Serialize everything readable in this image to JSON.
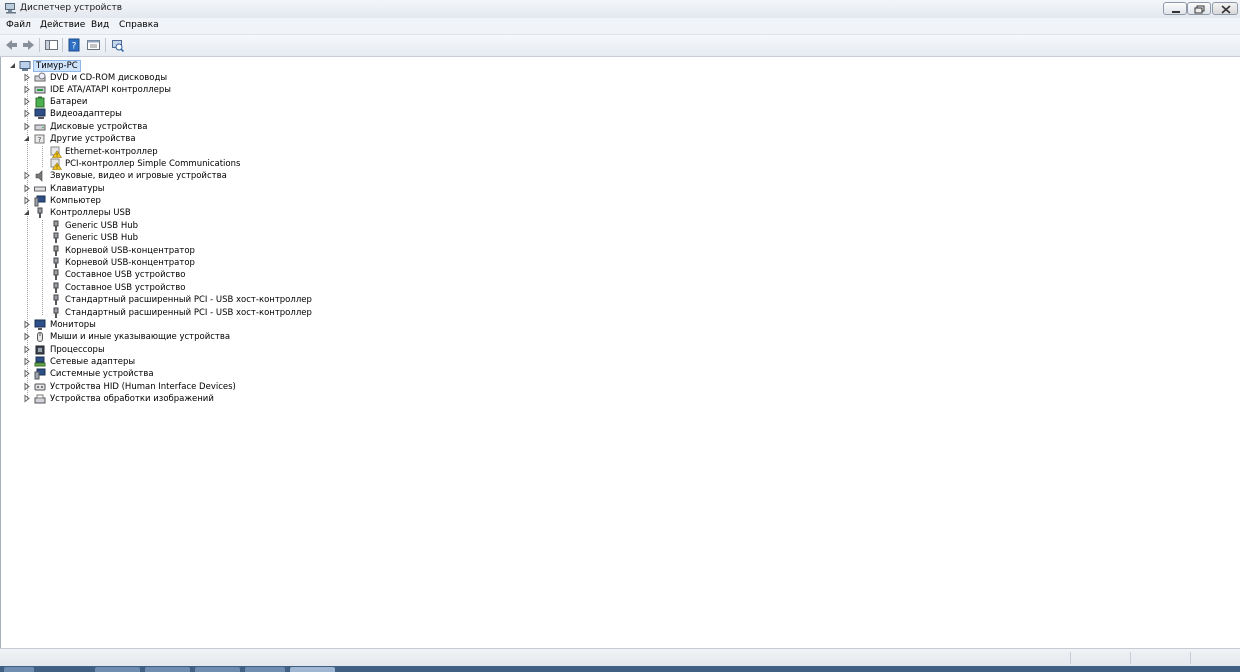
{
  "window": {
    "title": "Диспетчер устройств",
    "min_icon": "minimize-icon",
    "max_icon": "restore-icon",
    "close_icon": "close-icon"
  },
  "menu": {
    "file": "Файл",
    "action": "Действие",
    "view": "Вид",
    "help": "Справка"
  },
  "toolbar": {
    "buttons": [
      "back-arrow-icon",
      "forward-arrow-icon",
      "show-hide-console-tree-icon",
      "help-icon",
      "properties-icon",
      "scan-hardware-icon"
    ]
  },
  "tree": {
    "root": "Тимур-PC",
    "items": [
      {
        "label": "DVD и CD-ROM дисководы",
        "expanded": false
      },
      {
        "label": "IDE ATA/ATAPI контроллеры",
        "expanded": false
      },
      {
        "label": "Батареи",
        "expanded": false
      },
      {
        "label": "Видеоадаптеры",
        "expanded": false
      },
      {
        "label": "Дисковые устройства",
        "expanded": false
      },
      {
        "label": "Другие устройства",
        "expanded": true,
        "children": [
          "Ethernet-контроллер",
          "PCI-контроллер Simple Communications"
        ]
      },
      {
        "label": "Звуковые, видео и игровые устройства",
        "expanded": false
      },
      {
        "label": "Клавиатуры",
        "expanded": false
      },
      {
        "label": "Компьютер",
        "expanded": false
      },
      {
        "label": "Контроллеры USB",
        "expanded": true,
        "children": [
          "Generic USB Hub",
          "Generic USB Hub",
          "Корневой USB-концентратор",
          "Корневой USB-концентратор",
          "Составное USB устройство",
          "Составное USB устройство",
          "Стандартный расширенный PCI - USB хост-контроллер",
          "Стандартный расширенный PCI - USB хост-контроллер"
        ]
      },
      {
        "label": "Мониторы",
        "expanded": false
      },
      {
        "label": "Мыши и иные указывающие устройства",
        "expanded": false
      },
      {
        "label": "Процессоры",
        "expanded": false
      },
      {
        "label": "Сетевые адаптеры",
        "expanded": false
      },
      {
        "label": "Системные устройства",
        "expanded": false
      },
      {
        "label": "Устройства HID (Human Interface Devices)",
        "expanded": false
      },
      {
        "label": "Устройства обработки изображений",
        "expanded": false
      }
    ]
  },
  "colors": {
    "selection": "#cfe3fb",
    "warning": "#e8c020"
  }
}
